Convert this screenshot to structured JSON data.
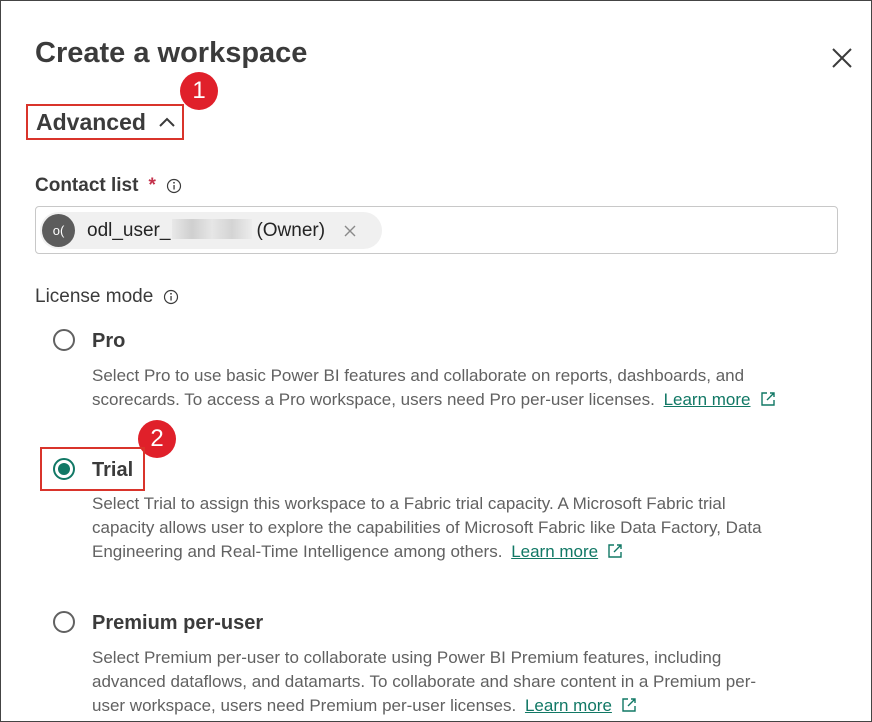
{
  "dialog": {
    "title": "Create a workspace"
  },
  "advanced": {
    "label": "Advanced"
  },
  "callouts": [
    "1",
    "2"
  ],
  "contact_list": {
    "label": "Contact list",
    "required_mark": "*",
    "chip": {
      "initials": "o(",
      "name": "odl_user_",
      "role": "(Owner)"
    }
  },
  "license_mode": {
    "label": "License mode",
    "options": [
      {
        "title": "Pro",
        "checked": false,
        "description_lines": [
          "Select Pro to use basic Power BI features and collaborate on reports, dashboards, and",
          "scorecards. To access a Pro workspace, users need Pro per-user licenses."
        ],
        "link": "Learn more"
      },
      {
        "title": "Trial",
        "checked": true,
        "description_lines": [
          "Select Trial to assign this workspace to a Fabric trial capacity. A Microsoft Fabric trial",
          "capacity allows user to explore the capabilities of Microsoft Fabric like Data Factory, Data",
          "Engineering and Real-Time Intelligence among others."
        ],
        "link": "Learn more"
      },
      {
        "title": "Premium per-user",
        "checked": false,
        "description_lines": [
          "Select Premium per-user to collaborate using Power BI Premium features, including",
          "advanced dataflows, and datamarts. To collaborate and share content in a Premium per-",
          "user workspace, users need Premium per-user licenses."
        ],
        "link": "Learn more"
      }
    ]
  },
  "colors": {
    "accent": "#117865",
    "callout": "#e0202a",
    "highlight_border": "#d9342b"
  }
}
